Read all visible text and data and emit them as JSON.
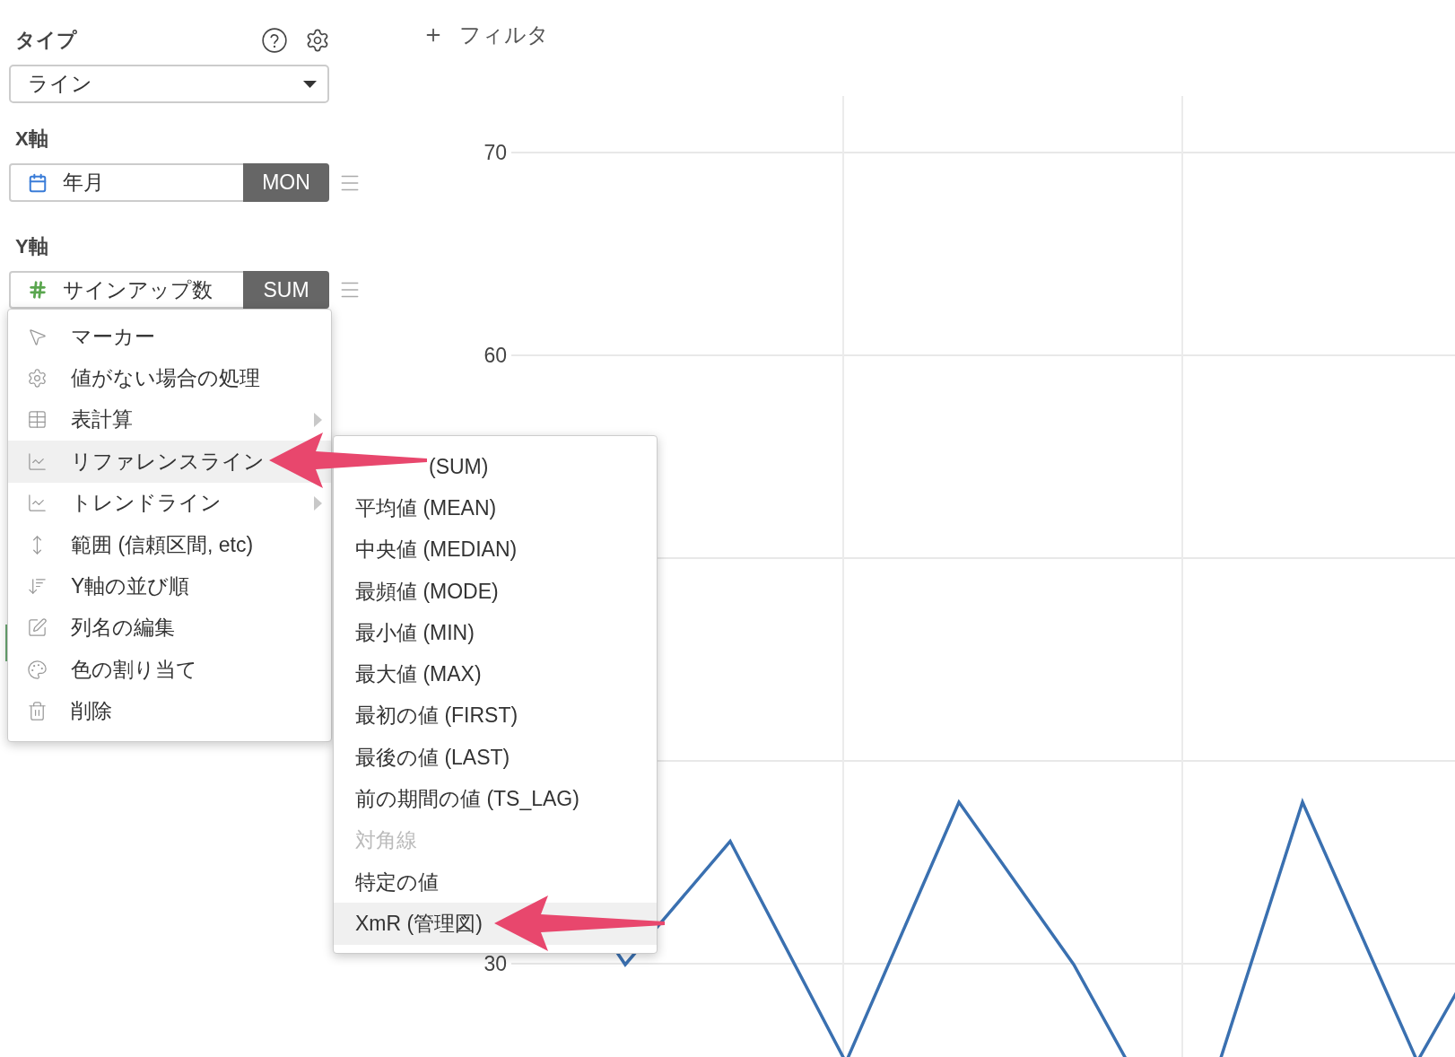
{
  "type_panel": {
    "label": "タイプ",
    "select": {
      "value": "ライン"
    }
  },
  "x_axis": {
    "label": "X軸",
    "field": {
      "kind": "date",
      "name": "年月",
      "aggregation": "MON"
    }
  },
  "y_axis": {
    "label": "Y軸",
    "field": {
      "kind": "number",
      "name": "サインアップ数",
      "aggregation": "SUM"
    }
  },
  "field_menu": {
    "items": [
      {
        "label": "マーカー",
        "selected": false,
        "has_submenu": false
      },
      {
        "label": "値がない場合の処理",
        "selected": false,
        "has_submenu": false
      },
      {
        "label": "表計算",
        "selected": false,
        "has_submenu": true
      },
      {
        "label": "リファレンスライン",
        "selected": true,
        "has_submenu": false
      },
      {
        "label": "トレンドライン",
        "selected": false,
        "has_submenu": true
      },
      {
        "label": "範囲 (信頼区間, etc)",
        "selected": false,
        "has_submenu": false
      },
      {
        "label": "Y軸の並び順",
        "selected": false,
        "has_submenu": false
      },
      {
        "label": "列名の編集",
        "selected": false,
        "has_submenu": false
      },
      {
        "label": "色の割り当て",
        "selected": false,
        "has_submenu": false
      },
      {
        "label": "削除",
        "selected": false,
        "has_submenu": false
      }
    ]
  },
  "reference_line_submenu": {
    "items": [
      {
        "label": "(SUM)",
        "selected": false,
        "disabled": false
      },
      {
        "label": "平均値 (MEAN)",
        "selected": false,
        "disabled": false
      },
      {
        "label": "中央値 (MEDIAN)",
        "selected": false,
        "disabled": false
      },
      {
        "label": "最頻値 (MODE)",
        "selected": false,
        "disabled": false
      },
      {
        "label": "最小値 (MIN)",
        "selected": false,
        "disabled": false
      },
      {
        "label": "最大値 (MAX)",
        "selected": false,
        "disabled": false
      },
      {
        "label": "最初の値 (FIRST)",
        "selected": false,
        "disabled": false
      },
      {
        "label": "最後の値 (LAST)",
        "selected": false,
        "disabled": false
      },
      {
        "label": "前の期間の値 (TS_LAG)",
        "selected": false,
        "disabled": false
      },
      {
        "label": "対角線",
        "selected": false,
        "disabled": true
      },
      {
        "label": "特定の値",
        "selected": false,
        "disabled": false
      },
      {
        "label": "XmR (管理図)",
        "selected": true,
        "disabled": false
      }
    ]
  },
  "filter_button": {
    "label": "フィルタ"
  },
  "chart": {
    "y_tick_labels": [
      "70",
      "60",
      "30"
    ]
  }
}
